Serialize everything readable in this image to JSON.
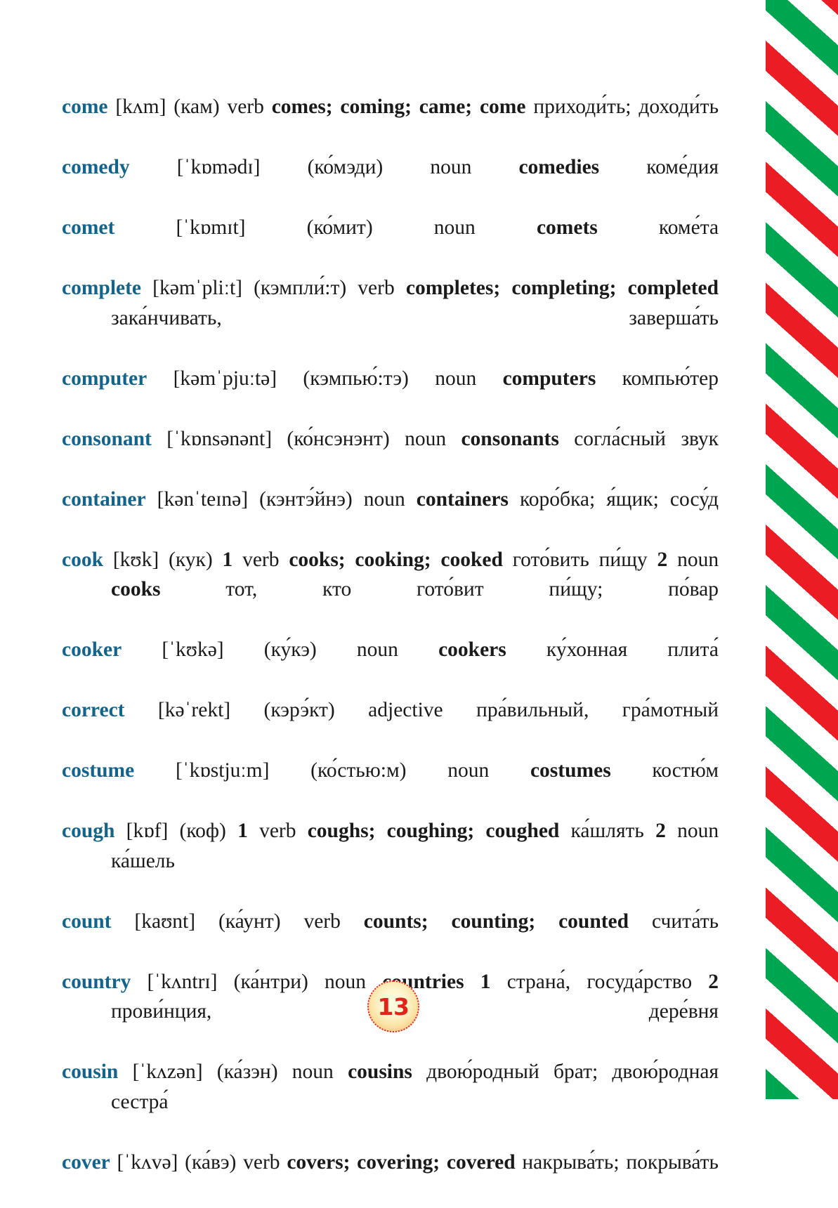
{
  "page": {
    "number": "13",
    "badge_color": "#e2231a",
    "headword_color": "#13648c",
    "text_color": "#1a1a1a"
  },
  "decoration": {
    "stripe_band": {
      "name": "diagonal-candy-stripe",
      "green": "#00a550",
      "red": "#ec1c24",
      "white": "#ffffff"
    }
  },
  "entries": [
    {
      "headword": "come",
      "ipa": "[kʌm]",
      "rus_transcription": "(кам)",
      "pos": "verb",
      "forms": "comes; coming; came; come",
      "definition": "приходи́ть;  доходи́ть"
    },
    {
      "headword": "comedy",
      "ipa": "[ˈkɒmədɪ]",
      "rus_transcription": "(ко́мэди)",
      "pos": "noun",
      "forms": "comedies",
      "definition": "коме́дия"
    },
    {
      "headword": "comet",
      "ipa": "[ˈkɒmɪt]",
      "rus_transcription": "(ко́мит)",
      "pos": "noun",
      "forms": "comets",
      "definition": "коме́та"
    },
    {
      "headword": "complete",
      "ipa": "[kəmˈpliːt]",
      "rus_transcription": "(кэмпли́:т)",
      "pos": "verb",
      "forms": "completes; completing; completed",
      "definition": "зака́нчивать,  заверша́ть"
    },
    {
      "headword": "computer",
      "ipa": "[kəmˈpjuːtə]",
      "rus_transcription": "(кэмпью́:тэ)",
      "pos": "noun",
      "forms": "computers",
      "definition": "компью́тер"
    },
    {
      "headword": "consonant",
      "ipa": "[ˈkɒnsənənt]",
      "rus_transcription": "(ко́нсэнэнт)",
      "pos": "noun",
      "forms": "consonants",
      "definition": "согла́сный  звук"
    },
    {
      "headword": "container",
      "ipa": "[kənˈteɪnə]",
      "rus_transcription": "(кэнтэ́йнэ)",
      "pos": "noun",
      "forms": "containers",
      "definition": "коро́бка;  я́щик;  сосу́д"
    },
    {
      "headword": "cook",
      "ipa": "[kʊk]",
      "rus_transcription": "(кук)",
      "senses": [
        {
          "number": "1",
          "pos": "verb",
          "forms": "cooks; cooking; cooked",
          "definition": "гото́вить  пи́щу"
        },
        {
          "number": "2",
          "pos": "noun",
          "forms": "cooks",
          "definition": "тот,  кто  гото́вит  пи́щу;  по́вар"
        }
      ]
    },
    {
      "headword": "cooker",
      "ipa": "[ˈkʊkə]",
      "rus_transcription": "(ку́кэ)",
      "pos": "noun",
      "forms": "cookers",
      "definition": "ку́хонная  плита́"
    },
    {
      "headword": "correct",
      "ipa": "[kəˈrekt]",
      "rus_transcription": "(кэрэ́кт)",
      "pos": "adjective",
      "forms": "",
      "definition": "пра́вильный,  гра́мотный"
    },
    {
      "headword": "costume",
      "ipa": "[ˈkɒstjuːm]",
      "rus_transcription": "(ко́стью:м)",
      "pos": "noun",
      "forms": "costumes",
      "definition": "костю́м"
    },
    {
      "headword": "cough",
      "ipa": "[kɒf]",
      "rus_transcription": "(коф)",
      "senses": [
        {
          "number": "1",
          "pos": "verb",
          "forms": "coughs; coughing; coughed",
          "definition": "ка́шлять"
        },
        {
          "number": "2",
          "pos": "noun",
          "forms": "",
          "definition": "ка́шель"
        }
      ]
    },
    {
      "headword": "count",
      "ipa": "[kaʊnt]",
      "rus_transcription": "(ка́унт)",
      "pos": "verb",
      "forms": "counts; counting; counted",
      "definition": "счита́ть"
    },
    {
      "headword": "country",
      "ipa": "[ˈkʌntrɪ]",
      "rus_transcription": "(ка́нтри)",
      "pos": "noun",
      "forms": "countries",
      "senses": [
        {
          "number": "1",
          "definition": "страна́,  госуда́рство"
        },
        {
          "number": "2",
          "definition": "прови́нция,  дере́вня"
        }
      ]
    },
    {
      "headword": "cousin",
      "ipa": "[ˈkʌzən]",
      "rus_transcription": "(ка́зэн)",
      "pos": "noun",
      "forms": "cousins",
      "definition": "двою́родный  брат;  двою́родная  сестра́"
    },
    {
      "headword": "cover",
      "ipa": "[ˈkʌvə]",
      "rus_transcription": "(ка́вэ)",
      "pos": "verb",
      "forms": "covers; covering; covered",
      "definition": "накрыва́ть;  покрыва́ть"
    }
  ]
}
